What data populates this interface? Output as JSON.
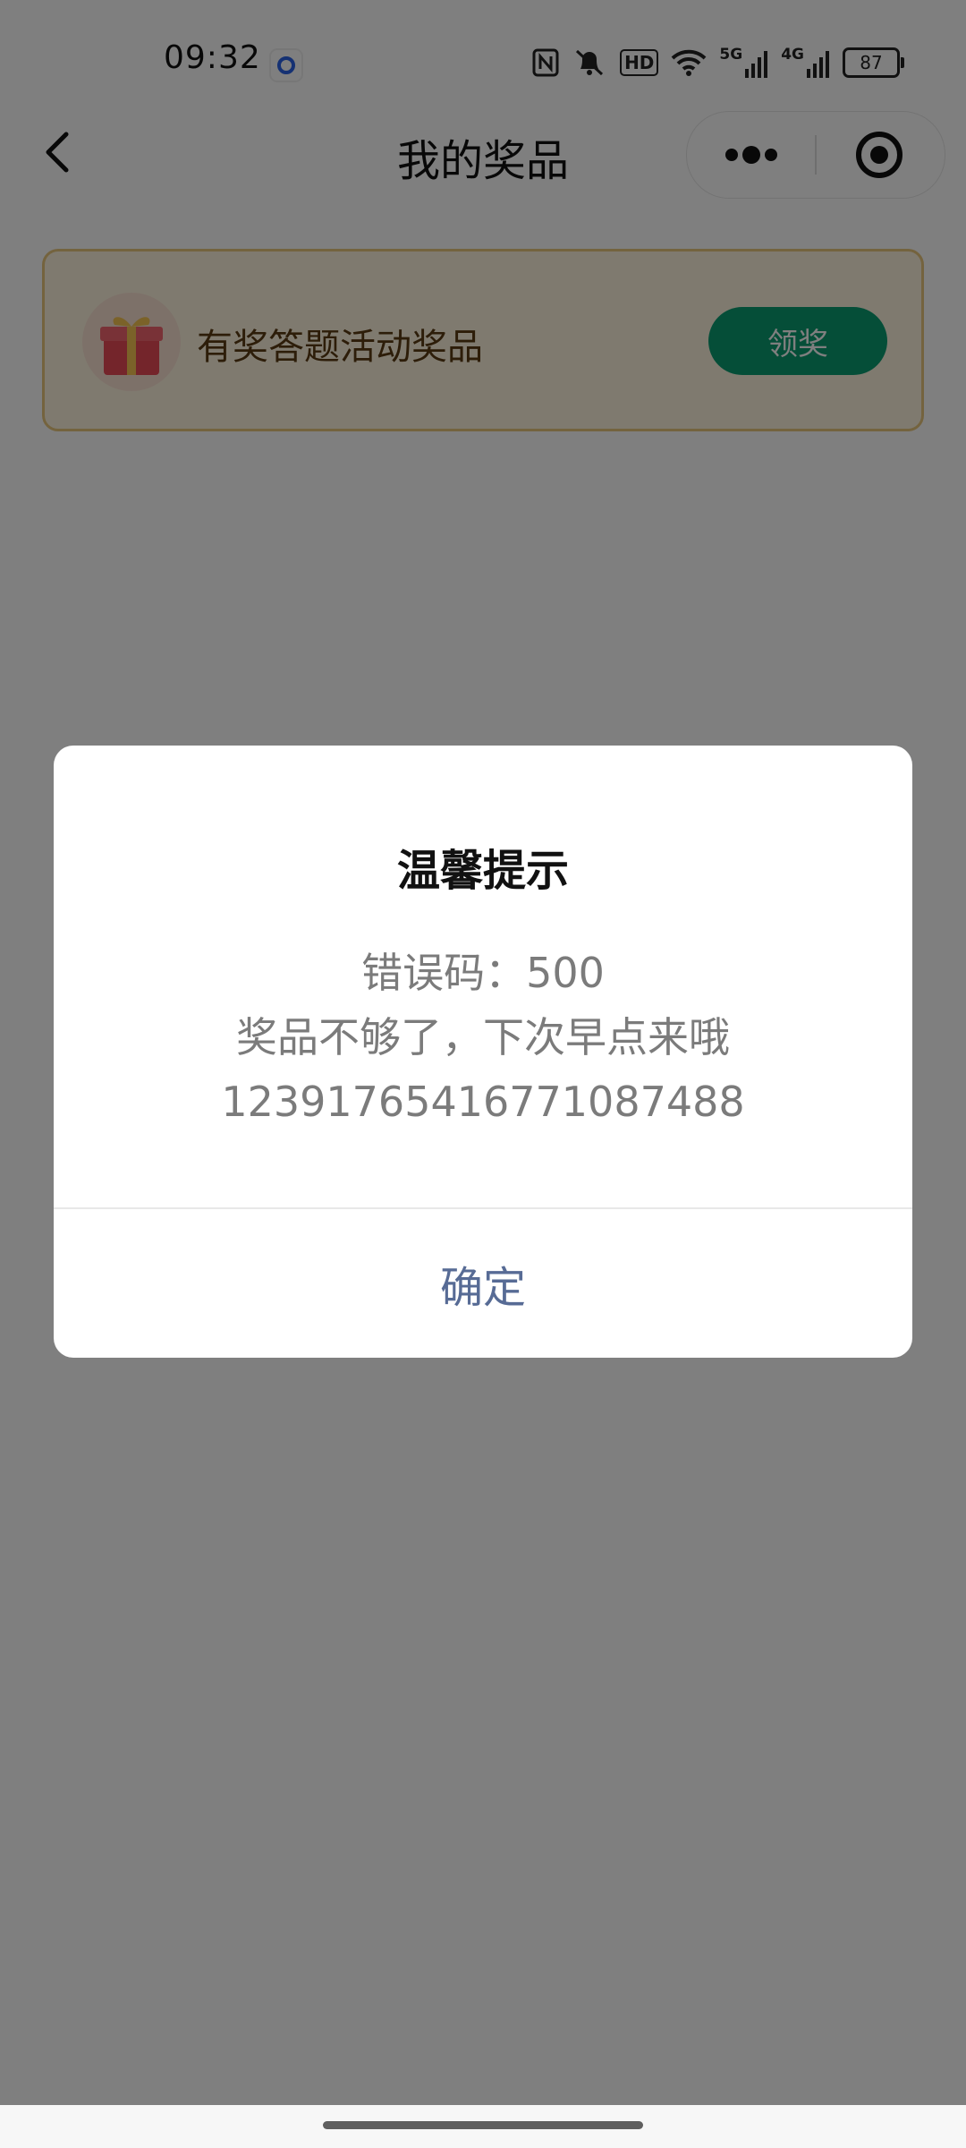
{
  "status_bar": {
    "time": "09:32",
    "icons": [
      "nfc-icon",
      "mute-bell-icon",
      "hd-icon",
      "wifi-icon",
      "5g-signal-icon",
      "4g-signal-icon"
    ],
    "hd_label": "HD",
    "sig5g_label": "5G",
    "sig4g_label": "4G",
    "battery": "87"
  },
  "nav": {
    "title": "我的奖品"
  },
  "prize_card": {
    "title": "有奖答题活动奖品",
    "claim_label": "领奖",
    "colors": {
      "border": "#e9c77c",
      "background": "#fff5df",
      "button": "#0b9c71"
    }
  },
  "dialog": {
    "title": "温馨提示",
    "lines": [
      "错误码：500",
      "奖品不够了，下次早点来哦",
      "1239176541677108748​8"
    ],
    "confirm_label": "确定",
    "colors": {
      "confirm": "#576b95",
      "message": "#7b7b7b"
    }
  }
}
